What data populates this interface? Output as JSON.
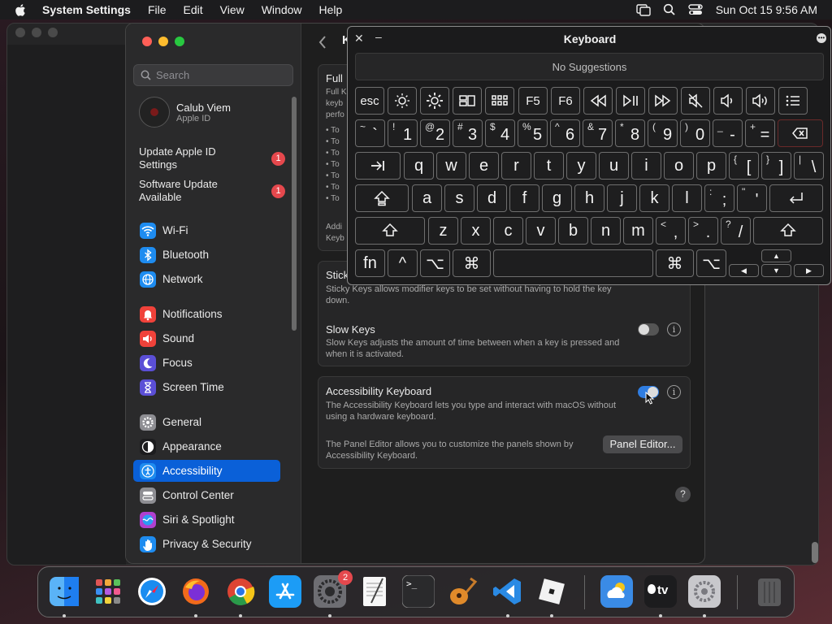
{
  "menubar": {
    "app": "System Settings",
    "items": [
      "File",
      "Edit",
      "View",
      "Window",
      "Help"
    ],
    "datetime": "Sun Oct 15  9:56 AM"
  },
  "sidebar": {
    "search_placeholder": "Search",
    "account": {
      "name": "Calub Viem",
      "subtitle": "Apple ID"
    },
    "updates": [
      {
        "label": "Update Apple ID Settings",
        "badge": "1"
      },
      {
        "label": "Software Update Available",
        "badge": "1"
      }
    ],
    "items": [
      {
        "label": "Wi-Fi",
        "icon": "wifi-icon",
        "color": "#1e8cf0"
      },
      {
        "label": "Bluetooth",
        "icon": "bluetooth-icon",
        "color": "#1e8cf0"
      },
      {
        "label": "Network",
        "icon": "globe-icon",
        "color": "#1e8cf0"
      },
      {
        "label": "Notifications",
        "icon": "bell-icon",
        "color": "#f0423a"
      },
      {
        "label": "Sound",
        "icon": "speaker-icon",
        "color": "#f0423a"
      },
      {
        "label": "Focus",
        "icon": "moon-icon",
        "color": "#5b4fd6"
      },
      {
        "label": "Screen Time",
        "icon": "hourglass-icon",
        "color": "#5b4fd6"
      },
      {
        "label": "General",
        "icon": "gear-icon",
        "color": "#8e8e93"
      },
      {
        "label": "Appearance",
        "icon": "appearance-icon",
        "color": "#1c1c1e"
      },
      {
        "label": "Accessibility",
        "icon": "accessibility-icon",
        "color": "#1e8cf0",
        "active": true
      },
      {
        "label": "Control Center",
        "icon": "control-center-icon",
        "color": "#8e8e93"
      },
      {
        "label": "Siri & Spotlight",
        "icon": "siri-icon",
        "color": "#b040d0"
      },
      {
        "label": "Privacy & Security",
        "icon": "hand-icon",
        "color": "#1e8cf0"
      }
    ]
  },
  "content": {
    "title_fragment": "K",
    "full_keyboard": {
      "title": "Full",
      "desc_lines": [
        "Full K",
        "keyb",
        "perfo"
      ],
      "bullets": [
        "• To",
        "• To",
        "• To",
        "• To",
        "• To",
        "• To",
        "• To"
      ],
      "additional": [
        "Addi",
        "Keyb"
      ]
    },
    "sticky_keys": {
      "title": "Stick",
      "desc": "Sticky Keys allows modifier keys to be set without having to hold the key down."
    },
    "slow_keys": {
      "title": "Slow Keys",
      "desc": "Slow Keys adjusts the amount of time between when a key is pressed and when it is activated.",
      "enabled": false
    },
    "accessibility_keyboard": {
      "title": "Accessibility Keyboard",
      "desc": "The Accessibility Keyboard lets you type and interact with macOS without using a hardware keyboard.",
      "enabled": true,
      "panel_desc": "The Panel Editor allows you to customize the panels shown by Accessibility Keyboard.",
      "panel_button": "Panel Editor..."
    },
    "help": "?"
  },
  "keyboard_viewer": {
    "title": "Keyboard",
    "suggestions": "No Suggestions",
    "fn_row": [
      "esc",
      "brightness-down-icon",
      "brightness-up-icon",
      "mission-control-icon",
      "launchpad-icon",
      "F5",
      "F6",
      "rewind-icon",
      "play-pause-icon",
      "fast-forward-icon",
      "mute-icon",
      "volume-down-icon",
      "volume-up-icon",
      "menu-icon"
    ],
    "num_row": [
      {
        "shift": "~",
        "main": "`"
      },
      {
        "shift": "!",
        "main": "1"
      },
      {
        "shift": "@",
        "main": "2"
      },
      {
        "shift": "#",
        "main": "3"
      },
      {
        "shift": "$",
        "main": "4"
      },
      {
        "shift": "%",
        "main": "5"
      },
      {
        "shift": "^",
        "main": "6"
      },
      {
        "shift": "&",
        "main": "7"
      },
      {
        "shift": "*",
        "main": "8"
      },
      {
        "shift": "(",
        "main": "9"
      },
      {
        "shift": ")",
        "main": "0"
      },
      {
        "shift": "_",
        "main": "-"
      },
      {
        "shift": "+",
        "main": "="
      }
    ],
    "row_q": [
      "q",
      "w",
      "e",
      "r",
      "t",
      "y",
      "u",
      "i",
      "o",
      "p"
    ],
    "row_q_punct": [
      {
        "shift": "{",
        "main": "["
      },
      {
        "shift": "}",
        "main": "]"
      },
      {
        "shift": "|",
        "main": "\\"
      }
    ],
    "row_a": [
      "a",
      "s",
      "d",
      "f",
      "g",
      "h",
      "j",
      "k",
      "l"
    ],
    "row_a_punct": [
      {
        "shift": ":",
        "main": ";"
      },
      {
        "shift": "\"",
        "main": "'"
      }
    ],
    "row_z": [
      "z",
      "x",
      "c",
      "v",
      "b",
      "n",
      "m"
    ],
    "row_z_punct": [
      {
        "shift": "<",
        "main": ","
      },
      {
        "shift": ">",
        "main": "."
      },
      {
        "shift": "?",
        "main": "/"
      }
    ],
    "bottom": {
      "fn": "fn",
      "ctrl": "^",
      "option": "⌥",
      "command": "⌘"
    }
  },
  "dock": {
    "apps": [
      {
        "name": "finder-icon",
        "color": "#1e7ef0"
      },
      {
        "name": "launchpad-icon",
        "color": "#d9d9d9"
      },
      {
        "name": "safari-icon",
        "color": "#1a8cf0"
      },
      {
        "name": "firefox-icon",
        "color": "#f26a1b"
      },
      {
        "name": "chrome-icon",
        "color": "#ffffff"
      },
      {
        "name": "app-store-icon",
        "color": "#1c9cf6"
      },
      {
        "name": "system-settings-icon",
        "color": "#8e8e93",
        "badge": "2"
      },
      {
        "name": "textedit-icon",
        "color": "#f2f2f2"
      },
      {
        "name": "terminal-icon",
        "color": "#1e1e1e"
      },
      {
        "name": "garageband-icon",
        "color": "#2c2c2c"
      },
      {
        "name": "vscode-icon",
        "color": "#ffffff"
      },
      {
        "name": "roblox-icon",
        "color": "#f2f2f2"
      },
      {
        "name": "weather-icon",
        "color": "#3a8be6"
      },
      {
        "name": "apple-tv-icon",
        "color": "#1c1c1e"
      },
      {
        "name": "settings-utility-icon",
        "color": "#c8c8cc"
      },
      {
        "name": "trash-icon",
        "color": "#6e6e6e"
      }
    ],
    "tv_label": "tv",
    "terminal_prompt": ">_"
  }
}
